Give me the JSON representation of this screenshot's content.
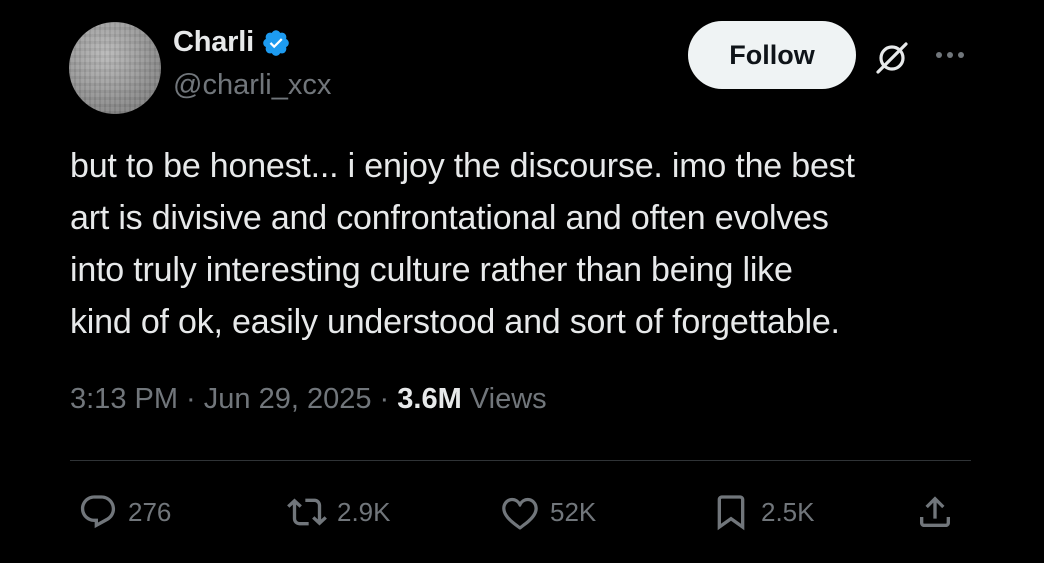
{
  "author": {
    "display_name": "Charli",
    "handle": "@charli_xcx",
    "verified": true
  },
  "header": {
    "follow_label": "Follow",
    "icons": [
      "grok-icon",
      "more-icon"
    ]
  },
  "tweet": {
    "text": "but to be honest... i enjoy the discourse.  imo the best\nart is divisive and confrontational and often evolves\ninto truly interesting culture rather than being like\nkind of ok, easily understood and sort of forgettable."
  },
  "meta": {
    "time": "3:13 PM",
    "separator_1": " · ",
    "date": "Jun 29, 2025",
    "separator_2": " · ",
    "views_count": "3.6M",
    "views_label": " Views"
  },
  "actions": {
    "replies": "276",
    "reposts": "2.9K",
    "likes": "52K",
    "bookmarks": "2.5K"
  },
  "colors": {
    "background": "#000000",
    "text_primary": "#e7e9ea",
    "text_secondary": "#71767b",
    "verified_blue": "#1d9bf0",
    "follow_bg": "#eff3f4",
    "divider": "#2f3336"
  }
}
